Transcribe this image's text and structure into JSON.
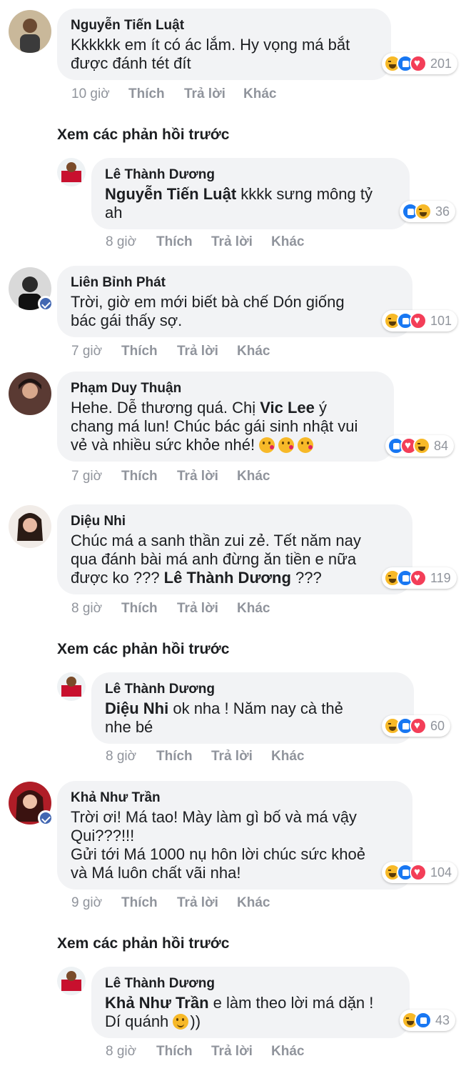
{
  "labels": {
    "like": "Thích",
    "reply": "Trả lời",
    "more": "Khác",
    "view_previous": "Xem các phản hồi trước"
  },
  "comments": [
    {
      "name": "Nguyễn Tiến Luật",
      "lines": [
        "Kkkkkk em ít có ác lắm. Hy vọng má bắt",
        "được đánh tét đít"
      ],
      "count": "201",
      "time": "10 giờ"
    },
    {
      "name": "Lê Thành Dương",
      "mention": "Nguyễn Tiến Luật",
      "line1_rest": " kkkk sưng mông tỷ",
      "line2": "ah",
      "count": "36",
      "time": "8 giờ"
    },
    {
      "name": "Liên Bỉnh Phát",
      "lines": [
        "Trời, giờ em mới biết bà chế Dón giống",
        "bác gái thấy sợ."
      ],
      "count": "101",
      "time": "7 giờ"
    },
    {
      "name": "Phạm Duy Thuận",
      "line1": "Hehe. Dễ thương quá. Chị ",
      "mention": "Vic Lee",
      "line1_rest": " ý",
      "line2": "chang má lun! Chúc bác gái sinh nhật vui",
      "line3": "vẻ và nhiều sức khỏe nhé! ",
      "count": "84",
      "time": "7 giờ"
    },
    {
      "name": "Diệu Nhi",
      "line1": "Chúc má a sanh thần zui zẻ. Tết năm nay",
      "line2": "qua đánh bài má anh đừng ăn tiền e nữa",
      "line3": "được ko ??? ",
      "mention": "Lê Thành Dương",
      "line3_rest": " ???",
      "count": "119",
      "time": "8 giờ"
    },
    {
      "name": "Lê Thành Dương",
      "mention": "Diệu Nhi",
      "line1_rest": " ok nha ! Năm nay cà thẻ",
      "line2": "nhe bé",
      "count": "60",
      "time": "8 giờ"
    },
    {
      "name": "Khả Như Trần",
      "lines": [
        "Trời ơi! Má tao! Mày làm gì bố và má vậy",
        "Qui???!!!",
        "Gửi tới Má 1000 nụ hôn lời chúc sức khoẻ",
        "và Má luôn chất vãi nha!"
      ],
      "count": "104",
      "time": "9 giờ"
    },
    {
      "name": "Lê Thành Dương",
      "mention": "Khả Như Trần",
      "line1_rest": " e làm theo lời má dặn !",
      "line2": "Dí quánh ",
      "line2_rest": "))",
      "count": "43",
      "time": "8 giờ"
    }
  ]
}
